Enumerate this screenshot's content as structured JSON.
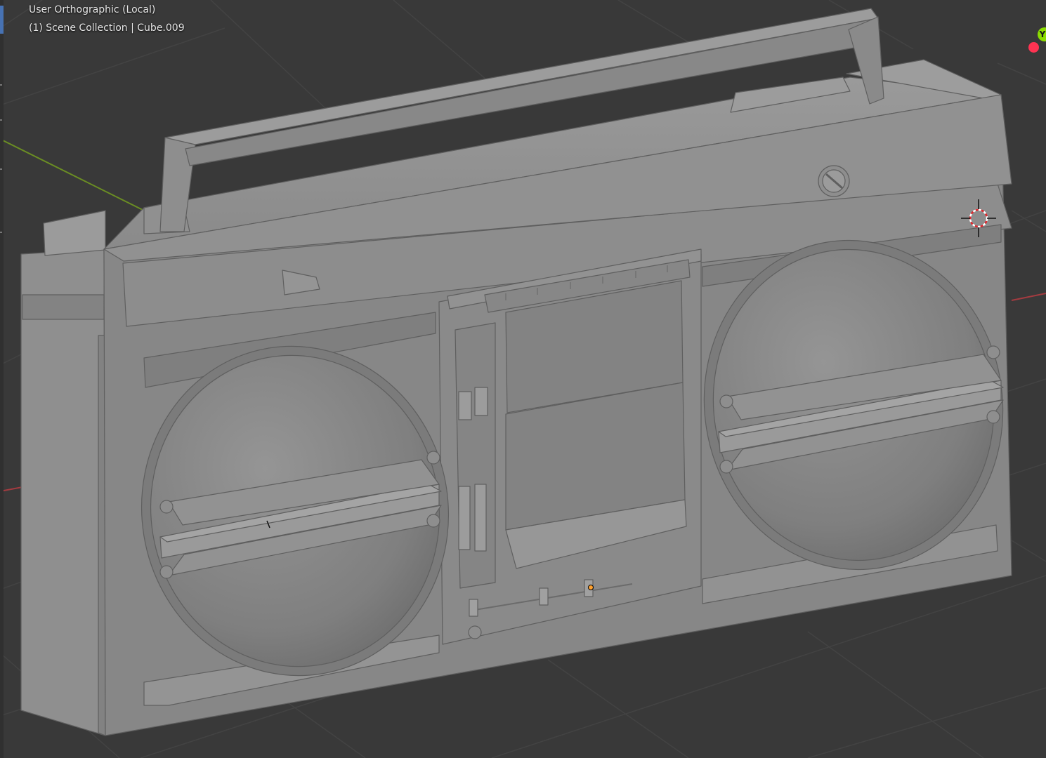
{
  "viewport": {
    "view_name": "User Orthographic (Local)",
    "collection_info": "(1) Scene Collection | Cube.009",
    "background_color": "#393939",
    "grid_color": "#434343",
    "x_axis_color": "#a43b40",
    "y_axis_color": "#6b8e23",
    "model_color": "#878787"
  },
  "gizmo": {
    "y_label": "Y",
    "y_color": "#8bdc00",
    "x_color": "#ff3352"
  },
  "icons": [
    "3d-cursor-icon",
    "origin-point-icon",
    "navigation-gizmo"
  ]
}
